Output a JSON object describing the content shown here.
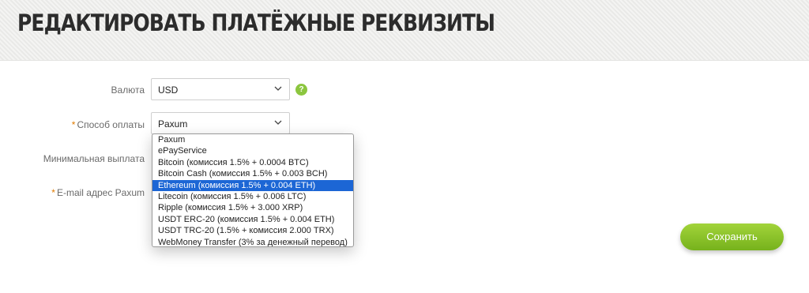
{
  "header": {
    "title": "РЕДАКТИРОВАТЬ ПЛАТЁЖНЫЕ РЕКВИЗИТЫ"
  },
  "form": {
    "currency": {
      "label": "Валюта",
      "value": "USD",
      "help": "?"
    },
    "payment_method": {
      "required_mark": "*",
      "label": "Способ оплаты",
      "value": "Paxum",
      "options": [
        "Paxum",
        "ePayService",
        "Bitcoin (комиссия 1.5% + 0.0004 BTC)",
        "Bitcoin Cash (комиссия 1.5% + 0.003 BCH)",
        "Ethereum (комиссия 1.5% + 0.004 ETH)",
        "Litecoin (комиссия 1.5% + 0.006 LTC)",
        "Ripple (комиссия 1.5% + 3.000 XRP)",
        "USDT ERC-20 (комиссия 1.5% + 0.004 ETH)",
        "USDT TRC-20 (1.5% + комиссия 2.000 TRX)",
        "WebMoney Transfer (3% за денежный перевод)"
      ],
      "highlighted_option": "Ethereum (комиссия 1.5% + 0.004 ETH)"
    },
    "min_payout": {
      "label": "Минимальная выплата"
    },
    "email": {
      "required_mark": "*",
      "label": "E-mail адрес Paxum"
    }
  },
  "actions": {
    "save_label": "Сохранить"
  },
  "colors": {
    "accent": "#8cc63f",
    "button": "#8cc63f",
    "highlight": "#1c66d5",
    "required": "#e07b00"
  }
}
